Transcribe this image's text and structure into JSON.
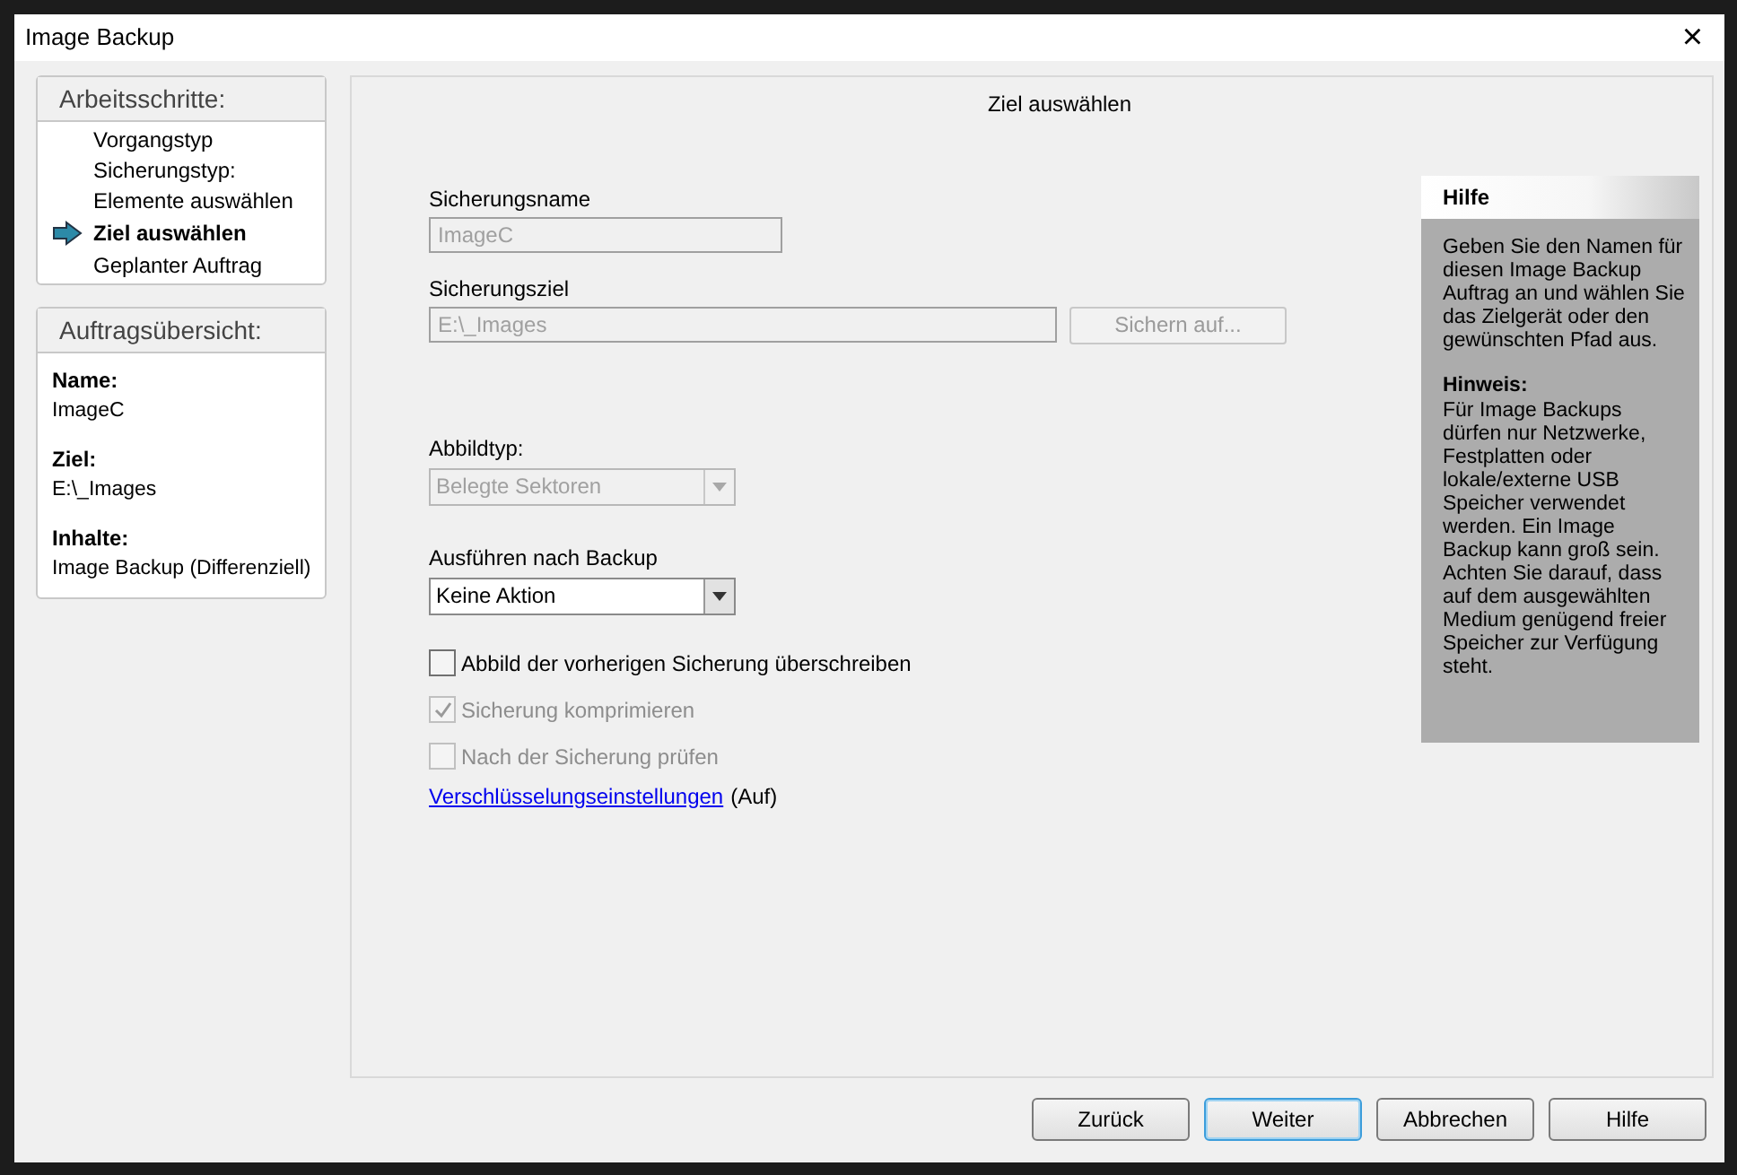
{
  "window": {
    "title": "Image Backup",
    "close": "×"
  },
  "steps": {
    "title": "Arbeitsschritte:",
    "items": [
      {
        "label": "Vorgangstyp",
        "selected": false
      },
      {
        "label": "Sicherungstyp:",
        "selected": false
      },
      {
        "label": "Elemente auswählen",
        "selected": false
      },
      {
        "label": "Ziel auswählen",
        "selected": true
      },
      {
        "label": "Geplanter Auftrag",
        "selected": false
      }
    ]
  },
  "summary": {
    "title": "Auftragsübersicht:",
    "entries": [
      {
        "label": "Name:",
        "value": "ImageC"
      },
      {
        "label": "Ziel:",
        "value": "E:\\_Images"
      },
      {
        "label": "Inhalte:",
        "value": "Image Backup (Differenziell)"
      }
    ]
  },
  "page_title": "Ziel auswählen",
  "name_field": {
    "label": "Sicherungsname",
    "value": "ImageC",
    "disabled": true
  },
  "target_field": {
    "label": "Sicherungsziel",
    "value": "E:\\_Images",
    "disabled": true,
    "button": "Sichern auf...",
    "button_disabled": true
  },
  "image_type": {
    "label": "Abbildtyp:",
    "value": "Belegte Sektoren",
    "disabled": true
  },
  "after_backup": {
    "label": "Ausführen nach Backup",
    "value": "Keine Aktion",
    "disabled": false
  },
  "options": [
    {
      "label": "Abbild der vorherigen Sicherung überschreiben",
      "checked": false,
      "disabled": false
    },
    {
      "label": "Sicherung komprimieren",
      "checked": true,
      "disabled": true
    },
    {
      "label": "Nach der Sicherung prüfen",
      "checked": false,
      "disabled": true
    }
  ],
  "encryption": {
    "link": "Verschlüsselungseinstellungen",
    "state": "(Auf)"
  },
  "help": {
    "title": "Hilfe",
    "text": "Geben Sie den Namen für diesen Image Backup Auftrag an und wählen Sie das Zielgerät oder den gewünschten Pfad aus.",
    "note_title": "Hinweis:",
    "note": "Für Image Backups dürfen nur Netzwerke, Festplatten oder lokale/externe USB Speicher verwendet werden. Ein Image Backup kann groß sein. Achten Sie darauf, dass auf dem ausgewählten Medium genügend freier Speicher zur Verfügung steht."
  },
  "buttons": [
    {
      "label": "Zurück",
      "default": false
    },
    {
      "label": "Weiter",
      "default": true
    },
    {
      "label": "Abbrechen",
      "default": false
    },
    {
      "label": "Hilfe",
      "default": false
    }
  ]
}
